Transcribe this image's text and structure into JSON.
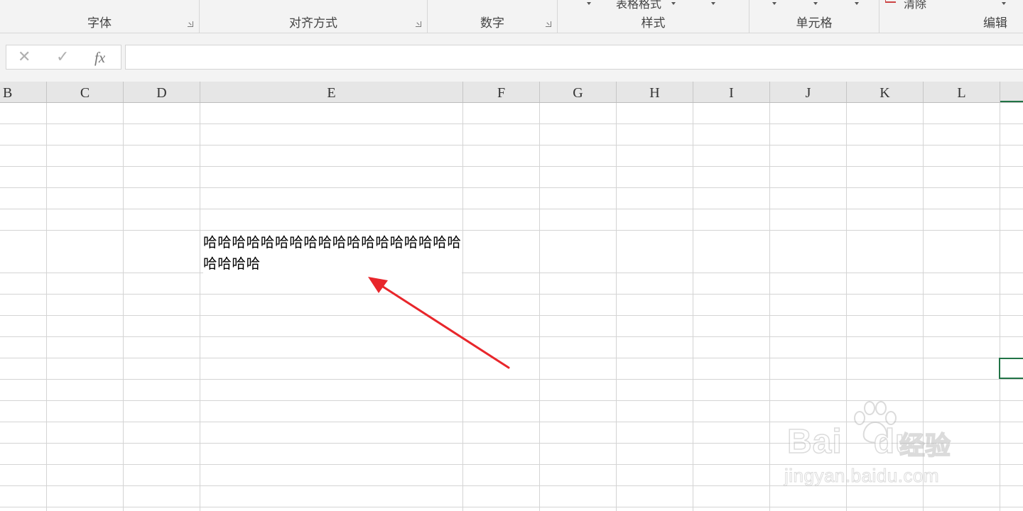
{
  "ribbon": {
    "groups": {
      "font": "字体",
      "alignment": "对齐方式",
      "number": "数字",
      "styles": "样式",
      "cells": "单元格",
      "editing": "编辑"
    },
    "clipped": {
      "table_format": "表格格式",
      "clear": "清除"
    }
  },
  "formula_bar": {
    "cancel_symbol": "✕",
    "enter_symbol": "✓",
    "fx_symbol": "fx",
    "value": ""
  },
  "sheet": {
    "columns": [
      "B",
      "C",
      "D",
      "E",
      "F",
      "G",
      "H",
      "I",
      "J",
      "K",
      "L"
    ],
    "cell_text": "哈哈哈哈哈哈哈哈哈哈哈哈哈哈哈哈哈哈哈哈哈哈",
    "selection_color": "#217346"
  },
  "annotation": {
    "arrow_color": "#e8262b"
  },
  "watermark": {
    "brand": "Bai",
    "brand_suffix": "du",
    "cn": "经验",
    "url": "jingyan.baidu.com"
  }
}
